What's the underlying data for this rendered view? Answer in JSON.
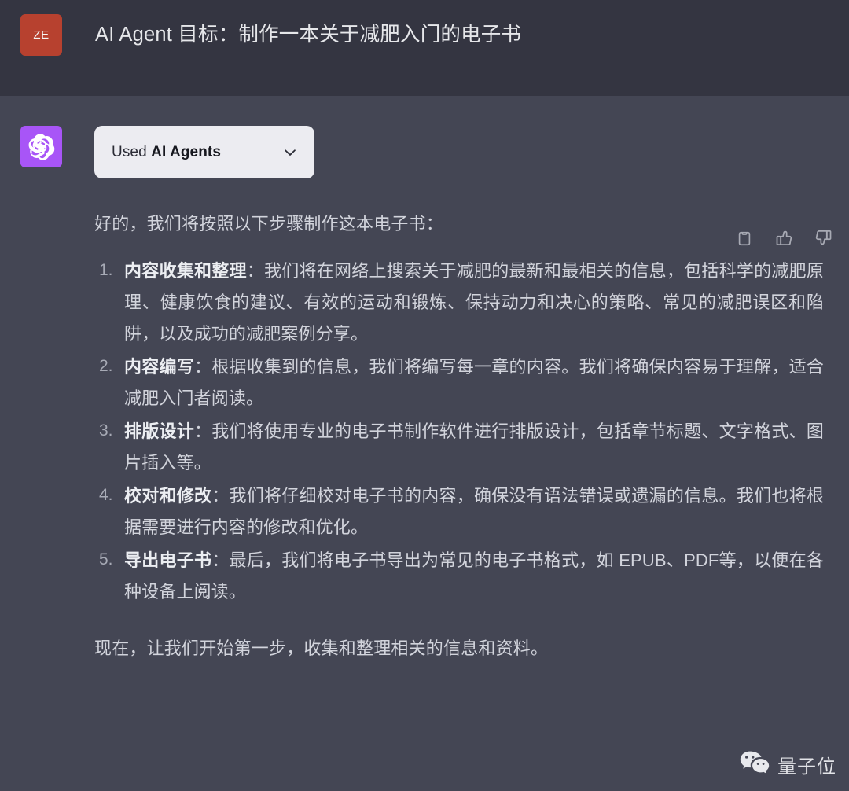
{
  "theme": {
    "header_bg": "#343541",
    "body_bg": "#444654",
    "user_avatar_bg": "#b7412f",
    "assistant_avatar_bg": "#a855f7",
    "pill_bg": "#ececf1",
    "body_text": "#d2d4dc",
    "bold_text": "#eceef2",
    "muted_text": "#a8abb6"
  },
  "prompt": {
    "avatar_initials": "ZE",
    "title": "AI Agent 目标：制作一本关于减肥入门的电子书"
  },
  "assistant": {
    "avatar_icon": "openai-logo-icon",
    "plugin_pill": {
      "prefix_label": "Used ",
      "plugin_name": "AI Agents",
      "chevron_icon": "chevron-down-icon"
    },
    "actions": [
      {
        "name": "copy-button",
        "icon": "clipboard-icon"
      },
      {
        "name": "thumbs-up-button",
        "icon": "thumbs-up-icon"
      },
      {
        "name": "thumbs-down-button",
        "icon": "thumbs-down-icon"
      }
    ],
    "intro": "好的，我们将按照以下步骤制作这本电子书：",
    "steps": [
      {
        "number": "1.",
        "title": "内容收集和整理",
        "body": "：我们将在网络上搜索关于减肥的最新和最相关的信息，包括科学的减肥原理、健康饮食的建议、有效的运动和锻炼、保持动力和决心的策略、常见的减肥误区和陷阱，以及成功的减肥案例分享。"
      },
      {
        "number": "2.",
        "title": "内容编写",
        "body": "：根据收集到的信息，我们将编写每一章的内容。我们将确保内容易于理解，适合减肥入门者阅读。"
      },
      {
        "number": "3.",
        "title": "排版设计",
        "body": "：我们将使用专业的电子书制作软件进行排版设计，包括章节标题、文字格式、图片插入等。"
      },
      {
        "number": "4.",
        "title": "校对和修改",
        "body": "：我们将仔细校对电子书的内容，确保没有语法错误或遗漏的信息。我们也将根据需要进行内容的修改和优化。"
      },
      {
        "number": "5.",
        "title": "导出电子书",
        "body": "：最后，我们将电子书导出为常见的电子书格式，如 EPUB、PDF等，以便在各种设备上阅读。"
      }
    ],
    "closing": "现在，让我们开始第一步，收集和整理相关的信息和资料。"
  },
  "watermark": {
    "icon": "wechat-icon",
    "label": "量子位"
  }
}
